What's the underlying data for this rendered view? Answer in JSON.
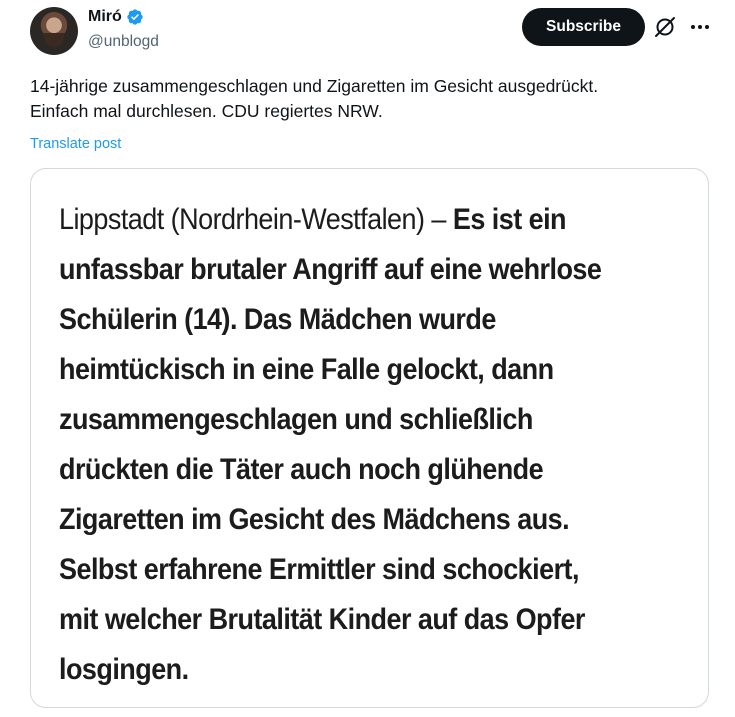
{
  "author": {
    "display_name": "Miró",
    "handle": "@unblogd",
    "verified": true
  },
  "actions": {
    "subscribe_label": "Subscribe",
    "grok_icon": "grok-icon",
    "more_icon": "more-icon"
  },
  "post": {
    "text_line1": "14-jährige zusammengeschlagen und Zigaretten im Gesicht ausgedrückt.",
    "text_line2": "Einfach mal durchlesen. CDU regiertes NRW.",
    "translate_label": "Translate post"
  },
  "media": {
    "lead": "Lippstadt (Nordrhein-Westfalen) – ",
    "line1_bold": "Es ist ein",
    "line2": "unfassbar brutaler Angriff auf eine wehrlose",
    "line3": "Schülerin (14). Das Mädchen wurde",
    "line4": "heimtückisch in eine Falle gelockt, dann",
    "line5": "zusammengeschlagen und schließlich",
    "line6": "drückten die Täter auch noch glühende",
    "line7": "Zigaretten im Gesicht des Mädchens aus.",
    "line8": "Selbst erfahrene Ermittler sind schockiert,",
    "line9": "mit welcher Brutalität Kinder auf das Opfer",
    "line10": "losgingen."
  },
  "colors": {
    "accent": "#1d9bf0",
    "text": "#0f1419",
    "secondary_text": "#536471",
    "border": "#cfd9de"
  }
}
